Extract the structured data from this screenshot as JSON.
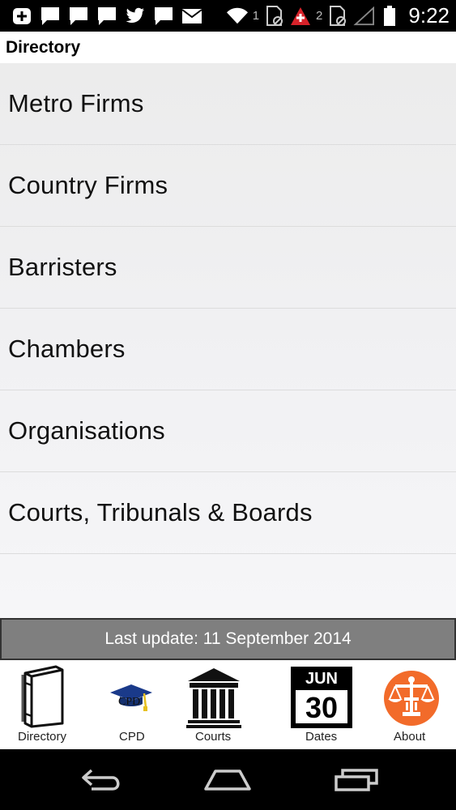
{
  "status_bar": {
    "sim1_number": "1",
    "sim2_number": "2",
    "time": "9:22"
  },
  "header": {
    "title": "Directory"
  },
  "directory_list": {
    "items": [
      {
        "label": "Metro Firms"
      },
      {
        "label": "Country Firms"
      },
      {
        "label": "Barristers"
      },
      {
        "label": "Chambers"
      },
      {
        "label": "Organisations"
      },
      {
        "label": "Courts, Tribunals & Boards"
      }
    ]
  },
  "update_banner": {
    "text": "Last update: 11 September 2014"
  },
  "tab_bar": {
    "tabs": [
      {
        "label": "Directory",
        "icon": "book-icon"
      },
      {
        "label": "CPD",
        "icon": "graduation-cap-icon",
        "icon_text": "CPD"
      },
      {
        "label": "Courts",
        "icon": "courthouse-icon"
      },
      {
        "label": "Dates",
        "icon": "calendar-icon",
        "month": "JUN",
        "day": "30"
      },
      {
        "label": "About",
        "icon": "scales-icon"
      }
    ]
  },
  "colors": {
    "banner_bg": "#7f7f7f",
    "about_orange": "#f26b2a",
    "cap_blue": "#1a3a8a"
  }
}
